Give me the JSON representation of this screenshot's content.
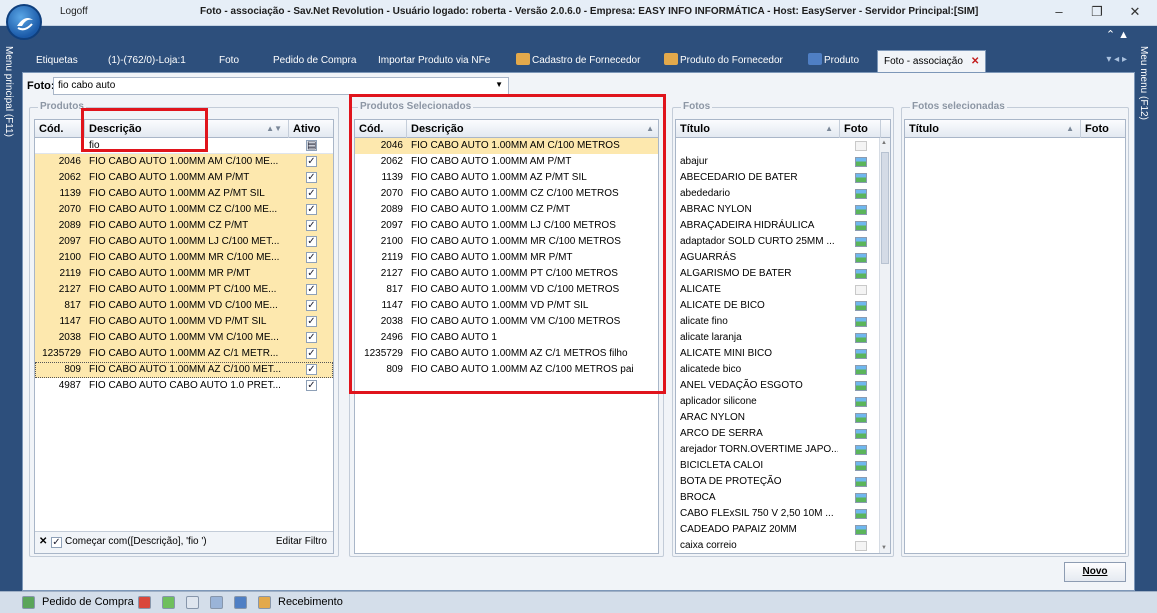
{
  "window": {
    "logoff_label": "Logoff",
    "title": "Foto - associação - Sav.Net Revolution - Usuário logado: roberta - Versão 2.0.6.0 - Empresa: EASY INFO INFORMÁTICA - Host: EasyServer - Servidor Principal:[SIM]",
    "minimize": "–",
    "restore": "❐",
    "close": "✕"
  },
  "tabs": [
    {
      "label": "Etiquetas",
      "icon": ""
    },
    {
      "label": "(1)-(762/0)-Loja:1",
      "icon": ""
    },
    {
      "label": "Foto",
      "icon": ""
    },
    {
      "label": "Pedido de Compra",
      "icon": ""
    },
    {
      "label": "Importar Produto via NFe",
      "icon": ""
    },
    {
      "label": "Cadastro de Fornecedor",
      "icon": "people-icon"
    },
    {
      "label": "Produto do Fornecedor",
      "icon": "people-icon"
    },
    {
      "label": "Produto",
      "icon": "product-icon"
    },
    {
      "label": "Foto - associação",
      "icon": "",
      "active": true
    }
  ],
  "sidebar": {
    "left": "Menu principal (F11)",
    "right": "Meu menu (F12)"
  },
  "foto": {
    "label": "Foto:",
    "value": "fio cabo auto"
  },
  "produtos": {
    "legend": "Produtos",
    "headers": {
      "cod": "Cód.",
      "desc": "Descrição",
      "ativo": "Ativo"
    },
    "filter_text": "fio",
    "rows": [
      {
        "cod": "2046",
        "desc": "FIO CABO AUTO  1.00MM AM C/100 ME..."
      },
      {
        "cod": "2062",
        "desc": "FIO CABO AUTO  1.00MM AM P/MT"
      },
      {
        "cod": "1139",
        "desc": "FIO CABO AUTO  1.00MM AZ P/MT SIL"
      },
      {
        "cod": "2070",
        "desc": "FIO CABO AUTO  1.00MM CZ C/100 ME..."
      },
      {
        "cod": "2089",
        "desc": "FIO CABO AUTO  1.00MM CZ P/MT"
      },
      {
        "cod": "2097",
        "desc": "FIO CABO AUTO  1.00MM LJ C/100 MET..."
      },
      {
        "cod": "2100",
        "desc": "FIO CABO AUTO  1.00MM MR C/100 ME..."
      },
      {
        "cod": "2119",
        "desc": "FIO CABO AUTO  1.00MM MR P/MT"
      },
      {
        "cod": "2127",
        "desc": "FIO CABO AUTO  1.00MM PT C/100 ME..."
      },
      {
        "cod": "817",
        "desc": "FIO CABO AUTO  1.00MM VD C/100 ME..."
      },
      {
        "cod": "1147",
        "desc": "FIO CABO AUTO  1.00MM VD P/MT SIL"
      },
      {
        "cod": "2038",
        "desc": "FIO CABO AUTO  1.00MM VM C/100 ME..."
      },
      {
        "cod": "1235729",
        "desc": "FIO CABO AUTO 1.00MM AZ C/1 METR..."
      },
      {
        "cod": "809",
        "desc": "FIO CABO AUTO  1.00MM AZ C/100 MET..."
      },
      {
        "cod": "4987",
        "desc": "FIO CABO AUTO CABO AUTO 1.0 PRET..."
      }
    ],
    "filter_expr": "Começar com([Descrição], 'fio ')",
    "edit_filter": "Editar Filtro"
  },
  "selecionados": {
    "legend": "Produtos Selecionados",
    "headers": {
      "cod": "Cód.",
      "desc": "Descrição"
    },
    "rows": [
      {
        "cod": "2046",
        "desc": "FIO CABO AUTO  1.00MM AM C/100 METROS"
      },
      {
        "cod": "2062",
        "desc": "FIO CABO AUTO  1.00MM AM P/MT"
      },
      {
        "cod": "1139",
        "desc": "FIO CABO AUTO  1.00MM AZ P/MT SIL"
      },
      {
        "cod": "2070",
        "desc": "FIO CABO AUTO  1.00MM CZ C/100 METROS"
      },
      {
        "cod": "2089",
        "desc": "FIO CABO AUTO  1.00MM CZ P/MT"
      },
      {
        "cod": "2097",
        "desc": "FIO CABO AUTO  1.00MM LJ C/100 METROS"
      },
      {
        "cod": "2100",
        "desc": "FIO CABO AUTO  1.00MM MR C/100 METROS"
      },
      {
        "cod": "2119",
        "desc": "FIO CABO AUTO  1.00MM MR P/MT"
      },
      {
        "cod": "2127",
        "desc": "FIO CABO AUTO  1.00MM PT C/100 METROS"
      },
      {
        "cod": "817",
        "desc": "FIO CABO AUTO  1.00MM VD C/100 METROS"
      },
      {
        "cod": "1147",
        "desc": "FIO CABO AUTO  1.00MM VD P/MT SIL"
      },
      {
        "cod": "2038",
        "desc": "FIO CABO AUTO  1.00MM VM C/100 METROS"
      },
      {
        "cod": "2496",
        "desc": "FIO CABO AUTO 1"
      },
      {
        "cod": "1235729",
        "desc": "FIO CABO AUTO 1.00MM AZ C/1 METROS filho"
      },
      {
        "cod": "809",
        "desc": "FIO CABO AUTO  1.00MM AZ C/100 METROS pai"
      }
    ]
  },
  "fotos": {
    "legend": "Fotos",
    "headers": {
      "titulo": "Título",
      "foto": "Foto"
    },
    "rows": [
      {
        "titulo": "",
        "blank": true
      },
      {
        "titulo": "abajur"
      },
      {
        "titulo": "ABECEDARIO DE BATER"
      },
      {
        "titulo": "abededario"
      },
      {
        "titulo": "ABRAC NYLON"
      },
      {
        "titulo": "ABRAÇADEIRA HIDRÁULICA"
      },
      {
        "titulo": "adaptador SOLD CURTO 25MM ..."
      },
      {
        "titulo": "AGUARRÁS"
      },
      {
        "titulo": "ALGARISMO DE BATER"
      },
      {
        "titulo": "ALICATE",
        "blank": true
      },
      {
        "titulo": "ALICATE DE BICO"
      },
      {
        "titulo": "alicate fino"
      },
      {
        "titulo": "alicate laranja"
      },
      {
        "titulo": "ALICATE MINI BICO"
      },
      {
        "titulo": "alicatede bico"
      },
      {
        "titulo": "ANEL VEDAÇÃO ESGOTO"
      },
      {
        "titulo": "aplicador silicone"
      },
      {
        "titulo": "ARAC NYLON"
      },
      {
        "titulo": "ARCO DE SERRA"
      },
      {
        "titulo": "arejador TORN.OVERTIME JAPO..."
      },
      {
        "titulo": "BICICLETA CALOI"
      },
      {
        "titulo": "BOTA DE PROTEÇÃO"
      },
      {
        "titulo": "BROCA"
      },
      {
        "titulo": "CABO FLExSIL 750 V 2,50 10M ..."
      },
      {
        "titulo": "CADEADO PAPAIZ 20MM"
      },
      {
        "titulo": "caixa correio",
        "blank": true
      }
    ]
  },
  "fotos_sel": {
    "legend": "Fotos selecionadas",
    "headers": {
      "titulo": "Título",
      "foto": "Foto"
    }
  },
  "novo_button": "Novo",
  "statusbar": {
    "label1": "Pedido de Compra",
    "label2": "Recebimento"
  },
  "colors": {
    "selected_row": "#fde8ae",
    "highlight_box": "#e0141c",
    "tabstrip": "#2d4f7c"
  }
}
